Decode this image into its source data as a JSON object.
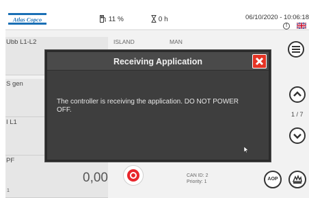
{
  "header": {
    "logo_text": "Atlas Copco",
    "fuel_level": "11 %",
    "running_hours": "0 h",
    "datetime": "06/10/2020 - 10:06:18",
    "alarm_icon_glyph": "!"
  },
  "panels": [
    {
      "label": "Ubb L1-L2"
    },
    {
      "label": "S gen"
    },
    {
      "label": "I L1"
    },
    {
      "label": "PF",
      "value": "0,00",
      "sub": "1"
    }
  ],
  "status": {
    "mode_a": "ISLAND",
    "mode_b": "MAN"
  },
  "can": {
    "id": "CAN ID: 2",
    "priority": "Priority: 1"
  },
  "navigation": {
    "page_indicator": "1 / 7",
    "aop_label": "AOP"
  },
  "dialog": {
    "title": "Receiving Application",
    "message": "The controller is receiving the application. DO NOT POWER OFF."
  },
  "colors": {
    "close_red": "#e53425",
    "power_red": "#e8262c",
    "logo_blue": "#1a6fb5",
    "dialog_bg": "#3e3e3e"
  },
  "icons": {
    "fuel": "fuel-pump-icon",
    "hours": "hourglass-icon",
    "alarm": "alarm-icon",
    "language": "uk-flag-icon",
    "menu": "menu-icon",
    "up": "chevron-up-icon",
    "down": "chevron-down-icon",
    "power": "power-button-icon",
    "hand": "manual-hand-icon",
    "close": "close-icon"
  }
}
